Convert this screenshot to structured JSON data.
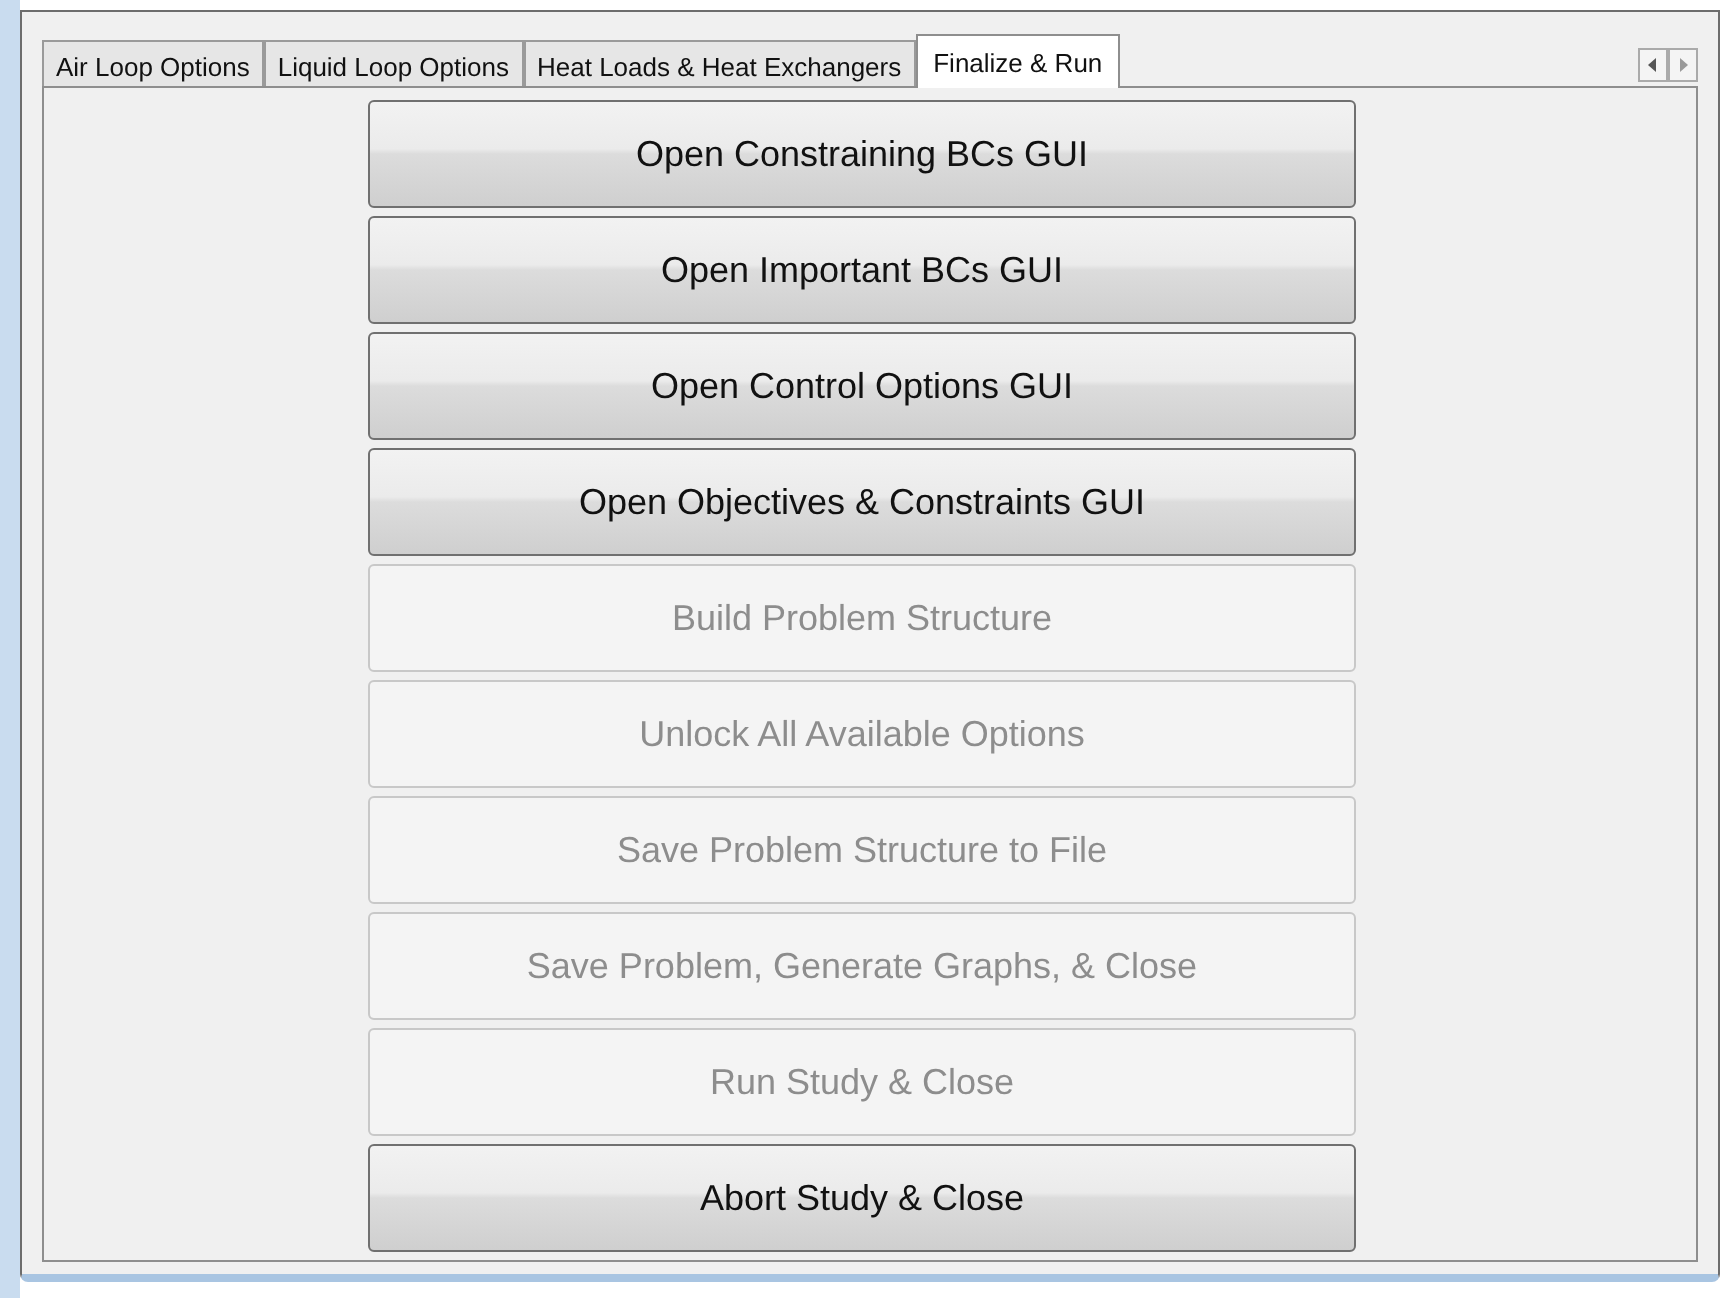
{
  "tabs": [
    {
      "label": "Air Loop Options",
      "selected": false
    },
    {
      "label": "Liquid Loop Options",
      "selected": false
    },
    {
      "label": "Heat Loads & Heat Exchangers",
      "selected": false
    },
    {
      "label": "Finalize & Run",
      "selected": true
    }
  ],
  "buttons": [
    {
      "label": "Open Constraining BCs GUI",
      "disabled": false
    },
    {
      "label": "Open Important BCs GUI",
      "disabled": false
    },
    {
      "label": "Open Control Options GUI",
      "disabled": false
    },
    {
      "label": "Open Objectives & Constraints GUI",
      "disabled": false
    },
    {
      "label": "Build Problem Structure",
      "disabled": true
    },
    {
      "label": "Unlock All Available Options",
      "disabled": true
    },
    {
      "label": "Save Problem Structure to File",
      "disabled": true
    },
    {
      "label": "Save Problem, Generate Graphs, & Close",
      "disabled": true
    },
    {
      "label": "Run Study & Close",
      "disabled": true
    },
    {
      "label": "Abort Study & Close",
      "disabled": false
    }
  ]
}
